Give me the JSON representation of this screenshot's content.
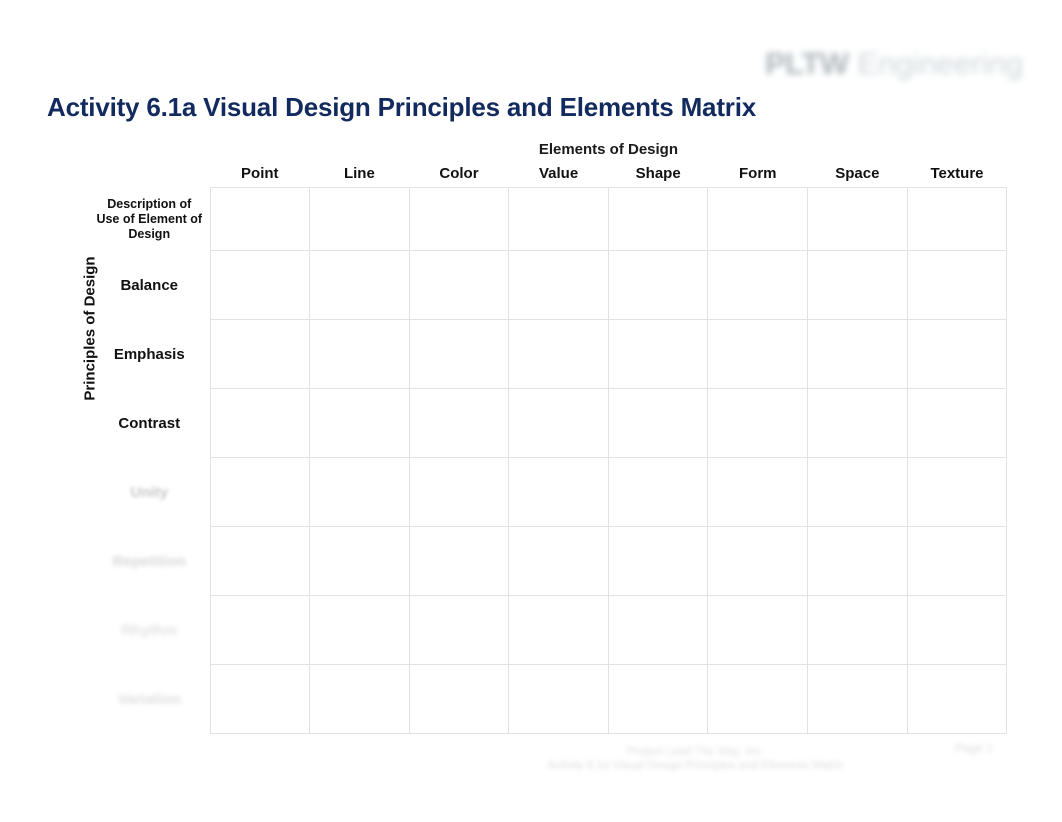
{
  "document": {
    "title": "Activity 6.1a Visual Design Principles and Elements Matrix"
  },
  "logo": {
    "mark": "PLTW",
    "word": "Engineering"
  },
  "matrix": {
    "column_group_header": "Elements of Design",
    "row_group_header": "Principles of Design",
    "row_header_column_label": "Description of\nUse of Element of\nDesign",
    "row_header_column_lines": [
      "Description of",
      "Use of Element of",
      "Design"
    ],
    "columns": [
      "Point",
      "Line",
      "Color",
      "Value",
      "Shape",
      "Form",
      "Space",
      "Texture"
    ],
    "rows": [
      {
        "label": "Balance",
        "faded": false,
        "cells": [
          "",
          "",
          "",
          "",
          "",
          "",
          "",
          ""
        ]
      },
      {
        "label": "Emphasis",
        "faded": false,
        "cells": [
          "",
          "",
          "",
          "",
          "",
          "",
          "",
          ""
        ]
      },
      {
        "label": "Contrast",
        "faded": false,
        "cells": [
          "",
          "",
          "",
          "",
          "",
          "",
          "",
          ""
        ]
      },
      {
        "label": "Unity",
        "faded": true,
        "cells": [
          "",
          "",
          "",
          "",
          "",
          "",
          "",
          ""
        ]
      },
      {
        "label": "Repetition",
        "faded": true,
        "cells": [
          "",
          "",
          "",
          "",
          "",
          "",
          "",
          ""
        ]
      },
      {
        "label": "Rhythm",
        "faded": true,
        "cells": [
          "",
          "",
          "",
          "",
          "",
          "",
          "",
          ""
        ]
      },
      {
        "label": "Variation",
        "faded": true,
        "cells": [
          "",
          "",
          "",
          "",
          "",
          "",
          "",
          ""
        ]
      }
    ]
  },
  "footer": {
    "line1": "Project Lead The Way, Inc.",
    "line2": "Activity 6.1a Visual Design Principles and Elements Matrix",
    "stamp": "Page 1"
  },
  "colors": {
    "title": "#122a5e",
    "header_band": "#cfd9e4",
    "grid_line": "#e2e2e4",
    "text": "#111111"
  }
}
